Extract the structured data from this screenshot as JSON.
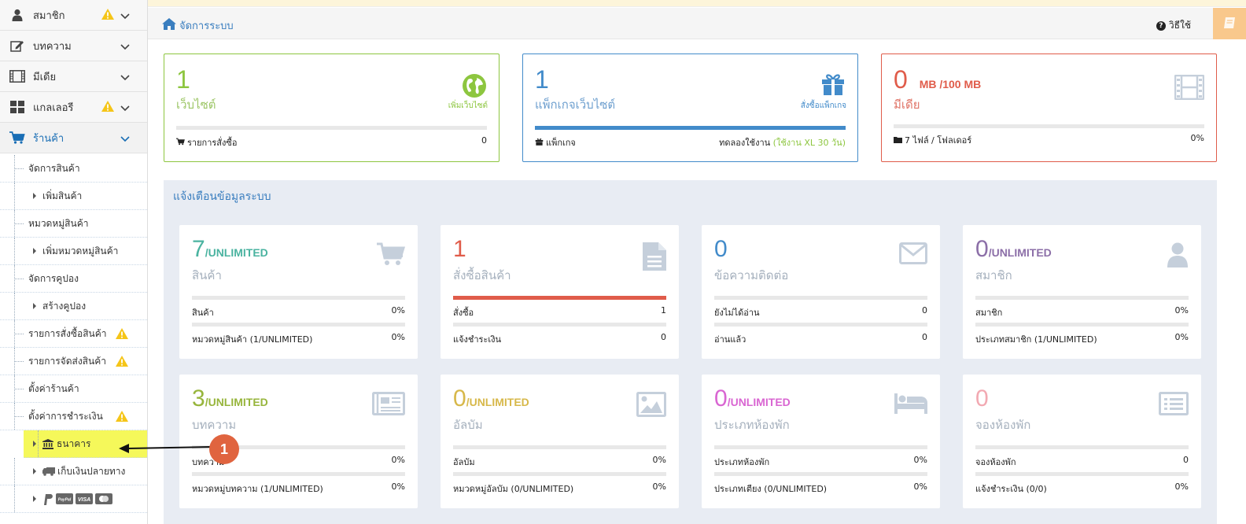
{
  "colors": {
    "green": "#8dc63f",
    "blue": "#428bca",
    "red": "#e05c4a",
    "teal": "#4ab3a0",
    "olive": "#97b53c",
    "gold": "#d7b84a",
    "magenta": "#d966d2",
    "purple": "#8c6fa8",
    "pink": "#f2a9b2",
    "icon_gray": "#c5cfdb",
    "highlight": "#f5f85a",
    "marker": "#e0643f",
    "warning": "#f5c518"
  },
  "sidebar": {
    "top_items": [
      {
        "label": "สมาชิก",
        "icon": "user-icon",
        "warning": true
      },
      {
        "label": "บทความ",
        "icon": "edit-icon",
        "warning": false
      },
      {
        "label": "มีเดีย",
        "icon": "film-icon",
        "warning": false
      },
      {
        "label": "แกลเลอรี",
        "icon": "grid-icon",
        "warning": true
      },
      {
        "label": "ร้านค้า",
        "icon": "cart-icon",
        "warning": false,
        "active": true
      }
    ],
    "sub_items": [
      {
        "label": "จัดการสินค้า",
        "level": 1,
        "warning": false
      },
      {
        "label": "เพิ่มสินค้า",
        "level": 2,
        "warning": false
      },
      {
        "label": "หมวดหมู่สินค้า",
        "level": 1,
        "warning": false
      },
      {
        "label": "เพิ่มหมวดหมู่สินค้า",
        "level": 2,
        "warning": false
      },
      {
        "label": "จัดการคูปอง",
        "level": 1,
        "warning": false
      },
      {
        "label": "สร้างคูปอง",
        "level": 2,
        "warning": false
      },
      {
        "label": "รายการสั่งซื้อสินค้า",
        "level": 1,
        "warning": true
      },
      {
        "label": "รายการจัดส่งสินค้า",
        "level": 1,
        "warning": true
      },
      {
        "label": "ตั้งค่าร้านค้า",
        "level": 1,
        "warning": false
      },
      {
        "label": "ตั้งค่าการชำระเงิน",
        "level": 1,
        "warning": true
      },
      {
        "label": "ธนาคาร",
        "level": 2,
        "icon": "bank-icon",
        "highlighted": true
      },
      {
        "label": "เก็บเงินปลายทาง",
        "level": 2,
        "icon": "truck-icon"
      },
      {
        "label": "",
        "level": 2,
        "icon": "payment-logos-icon",
        "logos": [
          "PayPal",
          "VISA"
        ]
      }
    ]
  },
  "topbar": {
    "breadcrumb": "จัดการระบบ",
    "help": "วิธีใช้"
  },
  "info_boxes": [
    {
      "value": "1",
      "unit": "",
      "title": "เว็บไซต์",
      "icon": "globe-icon",
      "icon_label": "เพิ่มเว็บไซต์",
      "foot_left": "รายการสั่งซื้อ",
      "foot_right": "0",
      "progress": 0
    },
    {
      "value": "1",
      "unit": "",
      "title": "แพ็กเกจเว็บไซต์",
      "icon": "gift-icon",
      "icon_label": "สั่งซื้อแพ็กเกจ",
      "foot_left": "แพ็กเกจ",
      "foot_right": "ทดลองใช้งาน",
      "foot_right_note": "(ใช้งาน XL 30 วัน)",
      "progress": 1
    },
    {
      "value": "0",
      "unit": "MB  /100 MB",
      "title": "มีเดีย",
      "icon": "film-icon",
      "icon_label": "",
      "foot_left": "7 ไฟล์ / โฟลเดอร์",
      "foot_right": "0%",
      "progress": 0
    }
  ],
  "panel": {
    "title": "แจ้งเตือนข้อมูลระบบ",
    "cards": [
      {
        "value": "7",
        "unit": "/UNLIMITED",
        "title": "สินค้า",
        "icon": "cart-icon",
        "row1_label": "สินค้า",
        "row1_value": "0%",
        "row2_label": "หมวดหมู่สินค้า (1/UNLIMITED)",
        "row2_value": "0%",
        "progress": 0
      },
      {
        "value": "1",
        "unit": "",
        "title": "สั่งซื้อสินค้า",
        "icon": "document-icon",
        "row1_label": "สั่งซื้อ",
        "row1_value": "1",
        "row2_label": "แจ้งชำระเงิน",
        "row2_value": "0",
        "progress": 1
      },
      {
        "value": "0",
        "unit": "",
        "title": "ข้อความติดต่อ",
        "icon": "envelope-icon",
        "row1_label": "ยังไม่ได้อ่าน",
        "row1_value": "0",
        "row2_label": "อ่านแล้ว",
        "row2_value": "0",
        "progress": 0
      },
      {
        "value": "0",
        "unit": "/UNLIMITED",
        "title": "สมาชิก",
        "icon": "user-icon",
        "row1_label": "สมาชิก",
        "row1_value": "0%",
        "row2_label": "ประเภทสมาชิก (1/UNLIMITED)",
        "row2_value": "0%",
        "progress": 0
      },
      {
        "value": "3",
        "unit": "/UNLIMITED",
        "title": "บทความ",
        "icon": "newspaper-icon",
        "row1_label": "บทความ",
        "row1_value": "0%",
        "row2_label": "หมวดหมู่บทความ (1/UNLIMITED)",
        "row2_value": "0%",
        "progress": 0
      },
      {
        "value": "0",
        "unit": "/UNLIMITED",
        "title": "อัลบัม",
        "icon": "image-icon",
        "row1_label": "อัลบัม",
        "row1_value": "0%",
        "row2_label": "หมวดหมู่อัลบัม (0/UNLIMITED)",
        "row2_value": "0%",
        "progress": 0
      },
      {
        "value": "0",
        "unit": "/UNLIMITED",
        "title": "ประเภทห้องพัก",
        "icon": "bed-icon",
        "row1_label": "ประเภทห้องพัก",
        "row1_value": "0%",
        "row2_label": "ประเภทเตียง (0/UNLIMITED)",
        "row2_value": "0%",
        "progress": 0
      },
      {
        "value": "0",
        "unit": "",
        "title": "จองห้องพัก",
        "icon": "list-icon",
        "row1_label": "จองห้องพัก",
        "row1_value": "0",
        "row2_label": "แจ้งชำระเงิน (0/0)",
        "row2_value": "0%",
        "progress": 0
      }
    ]
  },
  "annotation": {
    "number": "1"
  }
}
